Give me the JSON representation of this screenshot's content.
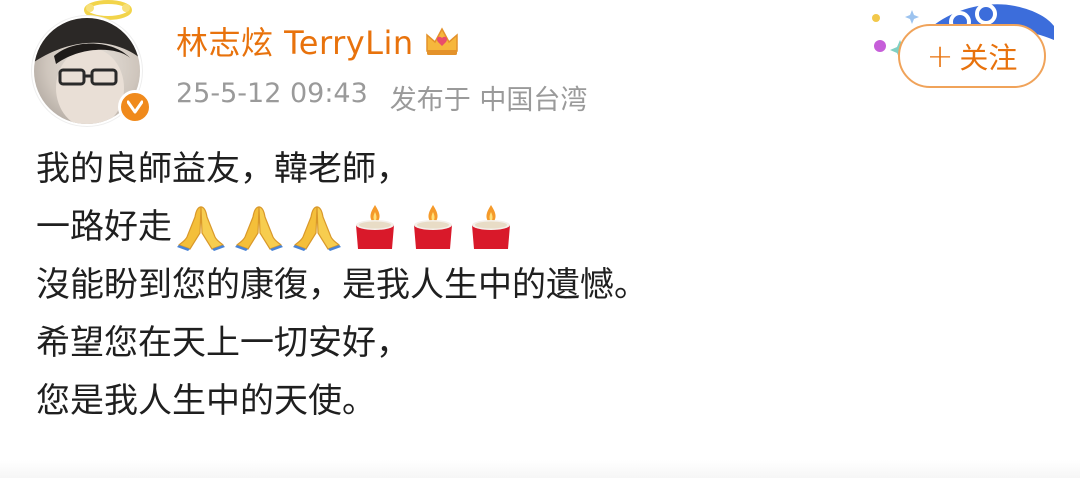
{
  "header": {
    "username": "林志炫 TerryLin",
    "timestamp": "25-5-12 09:43",
    "source": "发布于 中国台湾",
    "follow_plus": "+",
    "follow_label": "关注"
  },
  "post": {
    "lines": [
      "我的良師益友，韓老師，",
      "一路好走",
      "沒能盼到您的康復，是我人生中的遺憾。",
      "希望您在天上一切安好，",
      "您是我人生中的天使。"
    ],
    "emojis": [
      "folded-hands",
      "folded-hands",
      "folded-hands",
      "candle",
      "candle",
      "candle"
    ]
  },
  "colors": {
    "accent": "#e8720c",
    "meta_text": "#9a9a9a",
    "body_text": "#1f1f1f",
    "verified": "#f08a1c"
  }
}
